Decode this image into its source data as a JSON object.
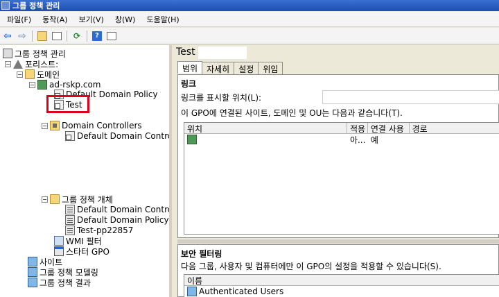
{
  "window": {
    "title": "그룹 정책 관리"
  },
  "menu": [
    "파일(F)",
    "동작(A)",
    "보기(V)",
    "창(W)",
    "도움말(H)"
  ],
  "toolbar": {
    "icons": [
      "back-arrow-icon",
      "forward-arrow-icon",
      "up-folder-icon",
      "show-hide-tree-icon",
      "refresh-icon",
      "help-icon",
      "properties-icon"
    ]
  },
  "tree": {
    "root": "그룹 정책 관리",
    "forest": "포리스트: ",
    "domains": "도메인",
    "domain": "ad-rskp.com",
    "default_domain_policy": "Default Domain Policy",
    "test": "Test",
    "domain_controllers": "Domain Controllers",
    "default_domain_controllers": "Default Domain Controlle",
    "gpo_objects": "그룹 정책 개체",
    "obj_ddcp": "Default Domain Controlle",
    "obj_ddp": "Default Domain Policy",
    "obj_test": "Test-pp22857",
    "wmi": "WMI 필터",
    "starter": "스타터 GPO",
    "sites": "사이트",
    "modeling": "그룹 정책 모델링",
    "results": "그룹 정책 결과"
  },
  "details": {
    "title": "Test",
    "tabs": [
      "범위",
      "자세히",
      "설정",
      "위임"
    ],
    "active_tab": "범위",
    "links_heading": "링크",
    "location_label": "링크를 표시할 위치(L):",
    "linked_text": "이 GPO에 연결된 사이트, 도메인 및 OU는 다음과 같습니다(T).",
    "columns": [
      "위치",
      "적용",
      "연결 사용",
      "경로"
    ],
    "rows": [
      {
        "location": "",
        "enforced": "아...",
        "enabled": "예",
        "path": ""
      }
    ],
    "security_heading": "보안 필터링",
    "security_text": "다음 그룹, 사용자 및 컴퓨터에만 이 GPO의 설정을 적용할 수 있습니다(S).",
    "security_column": "이름",
    "security_rows": [
      "Authenticated Users"
    ]
  }
}
